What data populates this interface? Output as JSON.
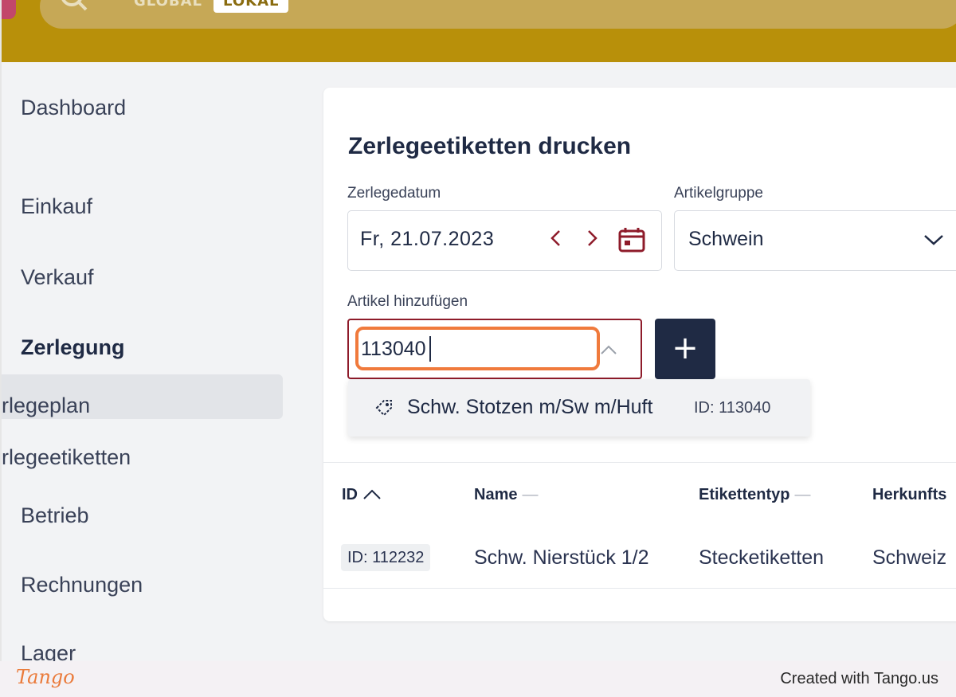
{
  "header": {
    "scope_global": "GLOBAL",
    "scope_lokal": "LOKAL"
  },
  "sidebar": {
    "items": [
      {
        "label": "Dashboard"
      },
      {
        "label": "Einkauf"
      },
      {
        "label": "Verkauf"
      },
      {
        "label": "Zerlegung"
      },
      {
        "label": "rlegeplan"
      },
      {
        "label": "rlegeetiketten"
      },
      {
        "label": "Betrieb"
      },
      {
        "label": "Rechnungen"
      },
      {
        "label": "Lager"
      }
    ]
  },
  "main": {
    "title": "Zerlegeetiketten drucken",
    "date_label": "Zerlegedatum",
    "date_value": "Fr,  21.07.2023",
    "group_label": "Artikelgruppe",
    "group_value": "Schwein",
    "article_label": "Artikel hinzufügen",
    "article_value": "113040",
    "add_label": "+",
    "suggestion": {
      "name": "Schw. Stotzen m/Sw m/Huft",
      "id": "ID: 113040"
    },
    "table": {
      "headers": [
        "ID",
        "Name",
        "Etikettentyp",
        "Herkunfts"
      ],
      "rows": [
        {
          "id": "ID: 112232",
          "name": "Schw. Nierstück 1/2",
          "type": "Stecketiketten",
          "origin": "Schweiz"
        }
      ]
    }
  },
  "footer": {
    "logo": "Tango",
    "credit": "Created with Tango.us"
  },
  "colors": {
    "topbar": "#b8900a",
    "accent": "#8e1b2a",
    "highlight": "#f07a3c",
    "primary_button": "#1f2a44"
  },
  "icons": [
    "search-icon",
    "chevron-left-icon",
    "chevron-right-icon",
    "calendar-icon",
    "chevron-down-icon",
    "chevron-up-icon",
    "plus-icon",
    "tag-icon",
    "sort-asc-icon"
  ]
}
